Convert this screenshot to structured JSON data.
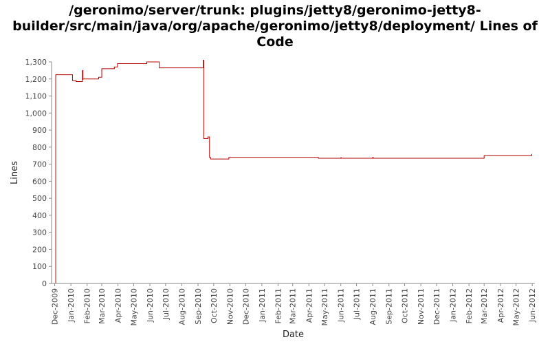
{
  "chart_data": {
    "type": "line",
    "title": "/geronimo/server/trunk: plugins/jetty8/geronimo-jetty8-builder/src/main/java/org/apache/geronimo/jetty8/deployment/ Lines of Code",
    "xlabel": "Date",
    "ylabel": "Lines",
    "ylim": [
      0,
      1300
    ],
    "yticks": [
      0,
      100,
      200,
      300,
      400,
      500,
      600,
      700,
      800,
      900,
      1000,
      1100,
      1200,
      1300
    ],
    "ytick_labels": [
      "0",
      "100",
      "200",
      "300",
      "400",
      "500",
      "600",
      "700",
      "800",
      "900",
      "1,000",
      "1,100",
      "1,200",
      "1,300"
    ],
    "xlim": [
      "2009-11-25",
      "2012-06-06"
    ],
    "xtick_labels": [
      "Dec-2009",
      "Jan-2010",
      "Feb-2010",
      "Mar-2010",
      "Apr-2010",
      "May-2010",
      "Jun-2010",
      "Jul-2010",
      "Aug-2010",
      "Sep-2010",
      "Oct-2010",
      "Nov-2010",
      "Dec-2010",
      "Jan-2011",
      "Feb-2011",
      "Mar-2011",
      "Apr-2011",
      "May-2011",
      "Jun-2011",
      "Jul-2011",
      "Aug-2011",
      "Sep-2011",
      "Oct-2011",
      "Nov-2011",
      "Dec-2011",
      "Jan-2012",
      "Feb-2012",
      "Mar-2012",
      "Apr-2012",
      "May-2012",
      "Jun-2012"
    ],
    "xtick_dates": [
      "2009-12-01",
      "2010-01-01",
      "2010-02-01",
      "2010-03-01",
      "2010-04-01",
      "2010-05-01",
      "2010-06-01",
      "2010-07-01",
      "2010-08-01",
      "2010-09-01",
      "2010-10-01",
      "2010-11-01",
      "2010-12-01",
      "2011-01-01",
      "2011-02-01",
      "2011-03-01",
      "2011-04-01",
      "2011-05-01",
      "2011-06-01",
      "2011-07-01",
      "2011-08-01",
      "2011-09-01",
      "2011-10-01",
      "2011-11-01",
      "2011-12-01",
      "2012-01-01",
      "2012-02-01",
      "2012-03-01",
      "2012-04-01",
      "2012-05-01",
      "2012-06-01"
    ],
    "series": [
      {
        "color": "#b30000",
        "step": true,
        "x": [
          "2009-12-03",
          "2009-12-03",
          "2010-01-04",
          "2010-01-11",
          "2010-01-23",
          "2010-01-23",
          "2010-01-24",
          "2010-01-24",
          "2010-02-23",
          "2010-03-01",
          "2010-03-25",
          "2010-03-31",
          "2010-05-26",
          "2010-06-19",
          "2010-09-11",
          "2010-09-11",
          "2010-09-12",
          "2010-09-12",
          "2010-09-20",
          "2010-09-23",
          "2010-09-25",
          "2010-10-30",
          "2011-04-19",
          "2011-06-01",
          "2011-06-02",
          "2011-07-31",
          "2011-08-01",
          "2011-08-02",
          "2012-03-01",
          "2012-05-30",
          "2012-05-31"
        ],
        "y": [
          0,
          1225,
          1190,
          1185,
          1195,
          1250,
          1195,
          1200,
          1210,
          1260,
          1270,
          1290,
          1300,
          1265,
          1265,
          1310,
          1265,
          850,
          860,
          740,
          730,
          740,
          735,
          738,
          735,
          735,
          740,
          735,
          750,
          750,
          760
        ]
      }
    ],
    "grid": false,
    "legend": "none"
  }
}
